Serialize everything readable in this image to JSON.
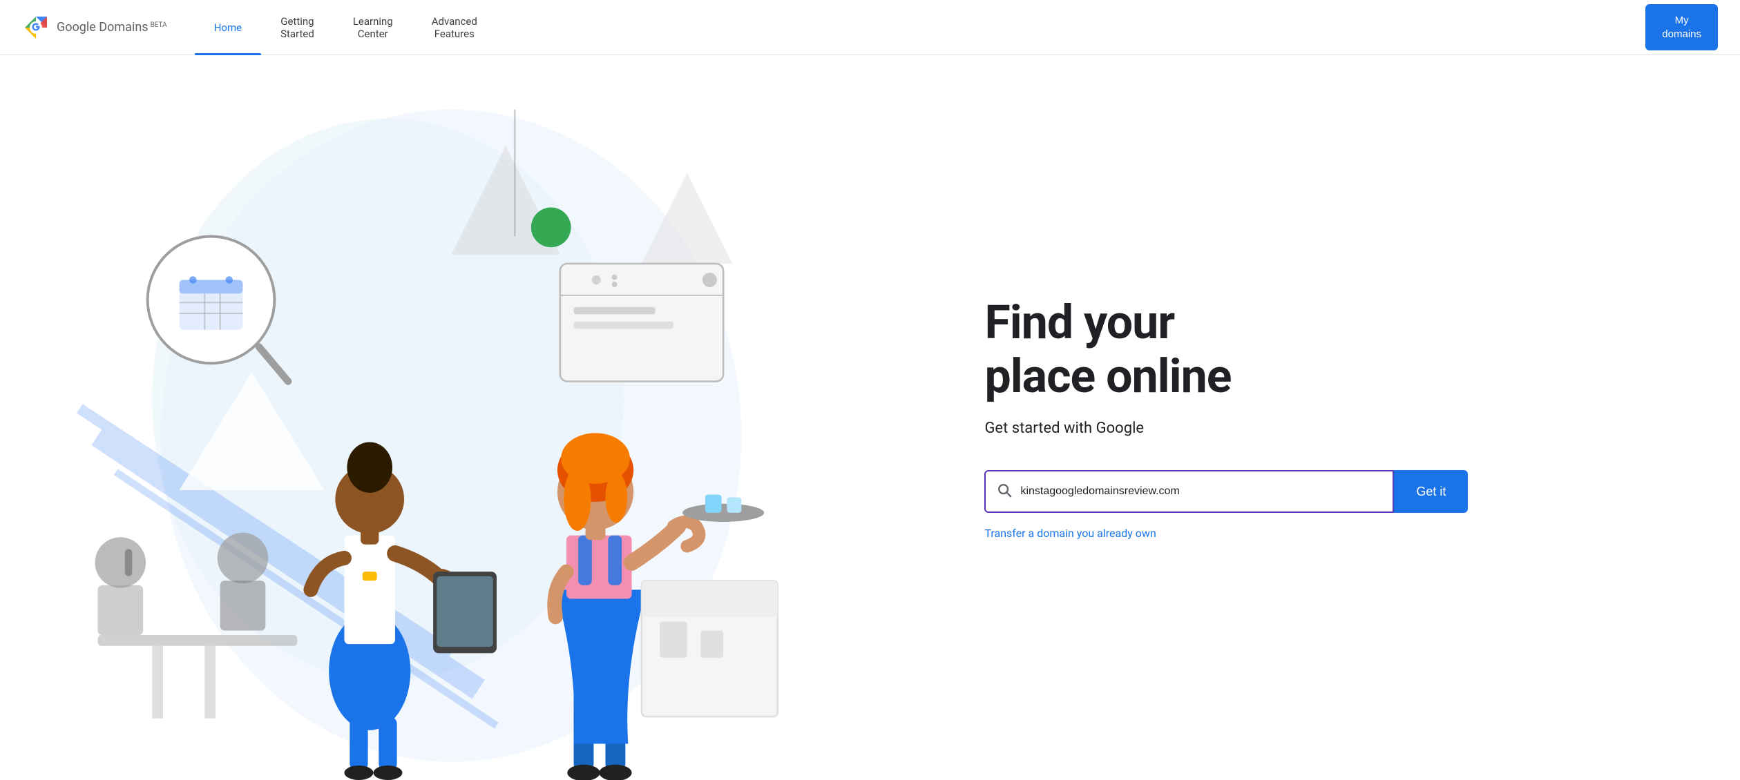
{
  "header": {
    "logo_text": "Google Domains",
    "logo_beta": "BETA",
    "nav": [
      {
        "id": "home",
        "label": "Home",
        "active": true
      },
      {
        "id": "getting-started",
        "label": "Getting\nStarted",
        "active": false
      },
      {
        "id": "learning-center",
        "label": "Learning\nCenter",
        "active": false
      },
      {
        "id": "advanced-features",
        "label": "Advanced\nFeatures",
        "active": false
      }
    ],
    "my_domains_label": "My\ndomains"
  },
  "hero": {
    "title": "Find your\nplace online",
    "subtitle": "Get started with Google",
    "search_placeholder": "kinstagoogledomainsreview.com",
    "search_value": "kinstagoogledomainsreview.com",
    "get_it_label": "Get it",
    "transfer_label": "Transfer a domain you already own"
  },
  "colors": {
    "accent_blue": "#1a73e8",
    "search_border": "#5c35b5",
    "nav_active": "#1a73e8"
  }
}
